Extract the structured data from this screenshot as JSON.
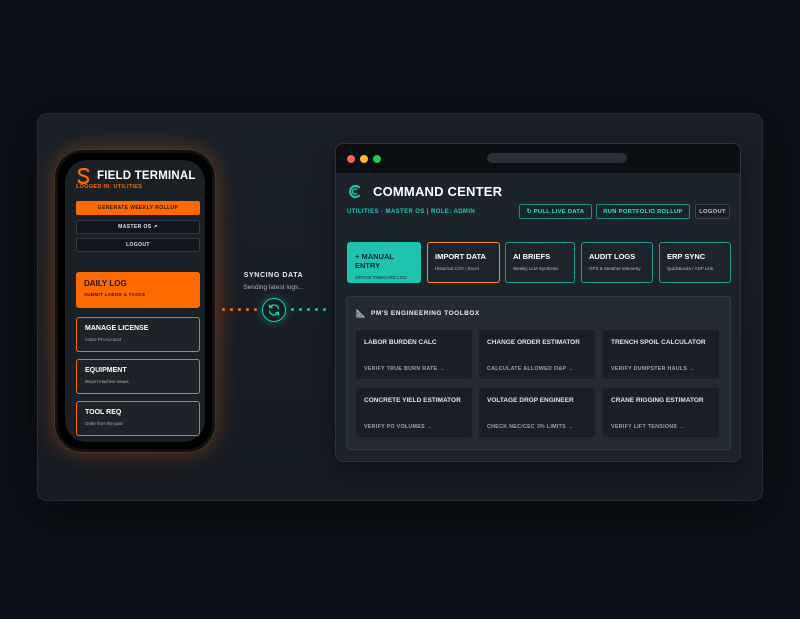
{
  "phone": {
    "title": "FIELD TERMINAL",
    "logged_in": "LOGGED IN: UTILITIES",
    "buttons": [
      "GENERATE WEEKLY ROLLUP",
      "MASTER OS ↗",
      "LOGOUT"
    ],
    "cards": [
      {
        "title": "DAILY LOG",
        "subtitle": "SUBMIT LABOR & TASKS"
      },
      {
        "title": "MANAGE LICENSE",
        "subtitle": "Active Pro Account"
      },
      {
        "title": "EQUIPMENT",
        "subtitle": "Report machine issues"
      },
      {
        "title": "TOOL REQ",
        "subtitle": "Order from the yard"
      }
    ]
  },
  "sync": {
    "title": "SYNCING DATA",
    "subtitle": "Sending latest logs..."
  },
  "command_center": {
    "title": "COMMAND CENTER",
    "subtitle": "UTILITIES - MASTER OS | ROLE: ADMIN",
    "actions": {
      "pull_live": "↻ PULL LIVE DATA",
      "run_rollup": "RUN PORTFOLIO ROLLUP",
      "logout": "LOGOUT"
    },
    "tiles": [
      {
        "title": "+ MANUAL ENTRY",
        "subtitle": "OFFICE TIMECARD LOG"
      },
      {
        "title": "IMPORT DATA",
        "subtitle": "Historical CSV / Excel"
      },
      {
        "title": "AI BRIEFS",
        "subtitle": "Weekly LLM Synthesis"
      },
      {
        "title": "AUDIT LOGS",
        "subtitle": "GPS & Weather telemetry"
      },
      {
        "title": "ERP SYNC",
        "subtitle": "QuickBooks / ADP Link"
      }
    ],
    "toolbox": {
      "title": "PM'S ENGINEERING TOOLBOX",
      "tools": [
        {
          "name": "LABOR BURDEN CALC",
          "link": "VERIFY TRUE BURN RATE →"
        },
        {
          "name": "CHANGE ORDER ESTIMATOR",
          "link": "CALCULATE ALLOWED O&P →"
        },
        {
          "name": "TRENCH SPOIL CALCULATOR",
          "link": "VERIFY DUMPSTER HAULS →"
        },
        {
          "name": "CONCRETE YIELD ESTIMATOR",
          "link": "VERIFY PO VOLUMES →"
        },
        {
          "name": "VOLTAGE DROP ENGINEER",
          "link": "CHECK NEC/CEC 3% LIMITS →"
        },
        {
          "name": "CRANE RIGGING ESTIMATOR",
          "link": "VERIFY LIFT TENSIONS →"
        }
      ]
    }
  },
  "colors": {
    "accent_orange": "#ff6a00",
    "accent_teal": "#1fc4b1",
    "background": "#0d1118"
  }
}
